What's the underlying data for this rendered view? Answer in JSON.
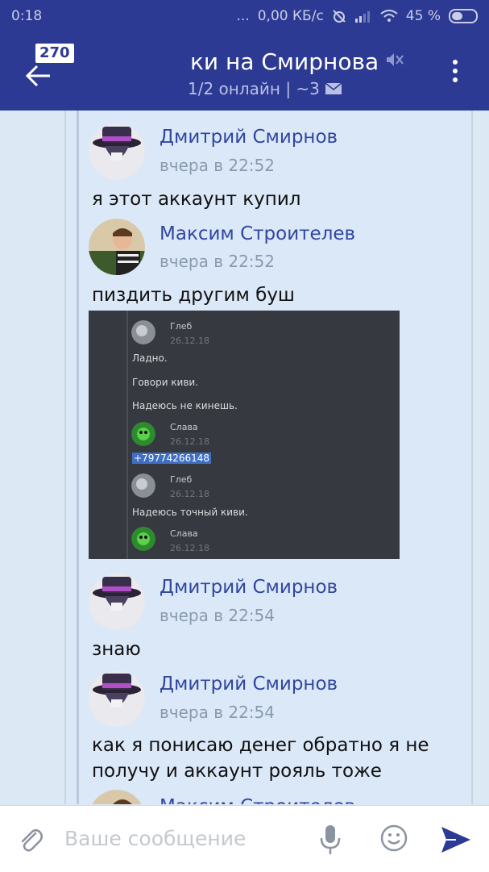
{
  "status_bar": {
    "time": "0:18",
    "dots": "...",
    "network_speed": "0,00 КБ/с",
    "battery_percent": "45 %",
    "battery_level": 0.45
  },
  "header": {
    "unread_badge": "270",
    "title": "ки на Смирнова",
    "subtitle": "1/2 онлайн | ~3"
  },
  "messages": [
    {
      "name": "Дмитрий Смирнов",
      "time": "вчера в 22:52",
      "text": "я этот аккаунт купил"
    },
    {
      "name": "Максим Строителев",
      "time": "вчера в 22:52",
      "text": "пиздить другим буш"
    },
    {
      "name": "Дмитрий Смирнов",
      "time": "вчера в 22:54",
      "text": "знаю"
    },
    {
      "name": "Дмитрий Смирнов",
      "time": "вчера в 22:54",
      "text_line1": "как я понисаю денег обратно я не",
      "text_line2": "получу и аккаунт рояль тоже"
    },
    {
      "name": "Максим Строителев"
    }
  ],
  "screenshot": {
    "entries": [
      {
        "name": "Глеб",
        "date": "26.12.18"
      },
      {
        "name": "Слава",
        "date": "26.12.18"
      },
      {
        "name": "Глеб",
        "date": "26.12.18"
      },
      {
        "name": "Слава",
        "date": "26.12.18"
      }
    ],
    "lines": [
      "Ладно.",
      "Говори киви.",
      "Надеюсь не кинешь.",
      "+79774266148",
      "Надеюсь точный киви."
    ]
  },
  "composer": {
    "placeholder": "Ваше сообщение"
  },
  "colors": {
    "header_bg": "#2d3a93",
    "chat_bg": "#dbe8f8",
    "name_color": "#3146a0"
  }
}
